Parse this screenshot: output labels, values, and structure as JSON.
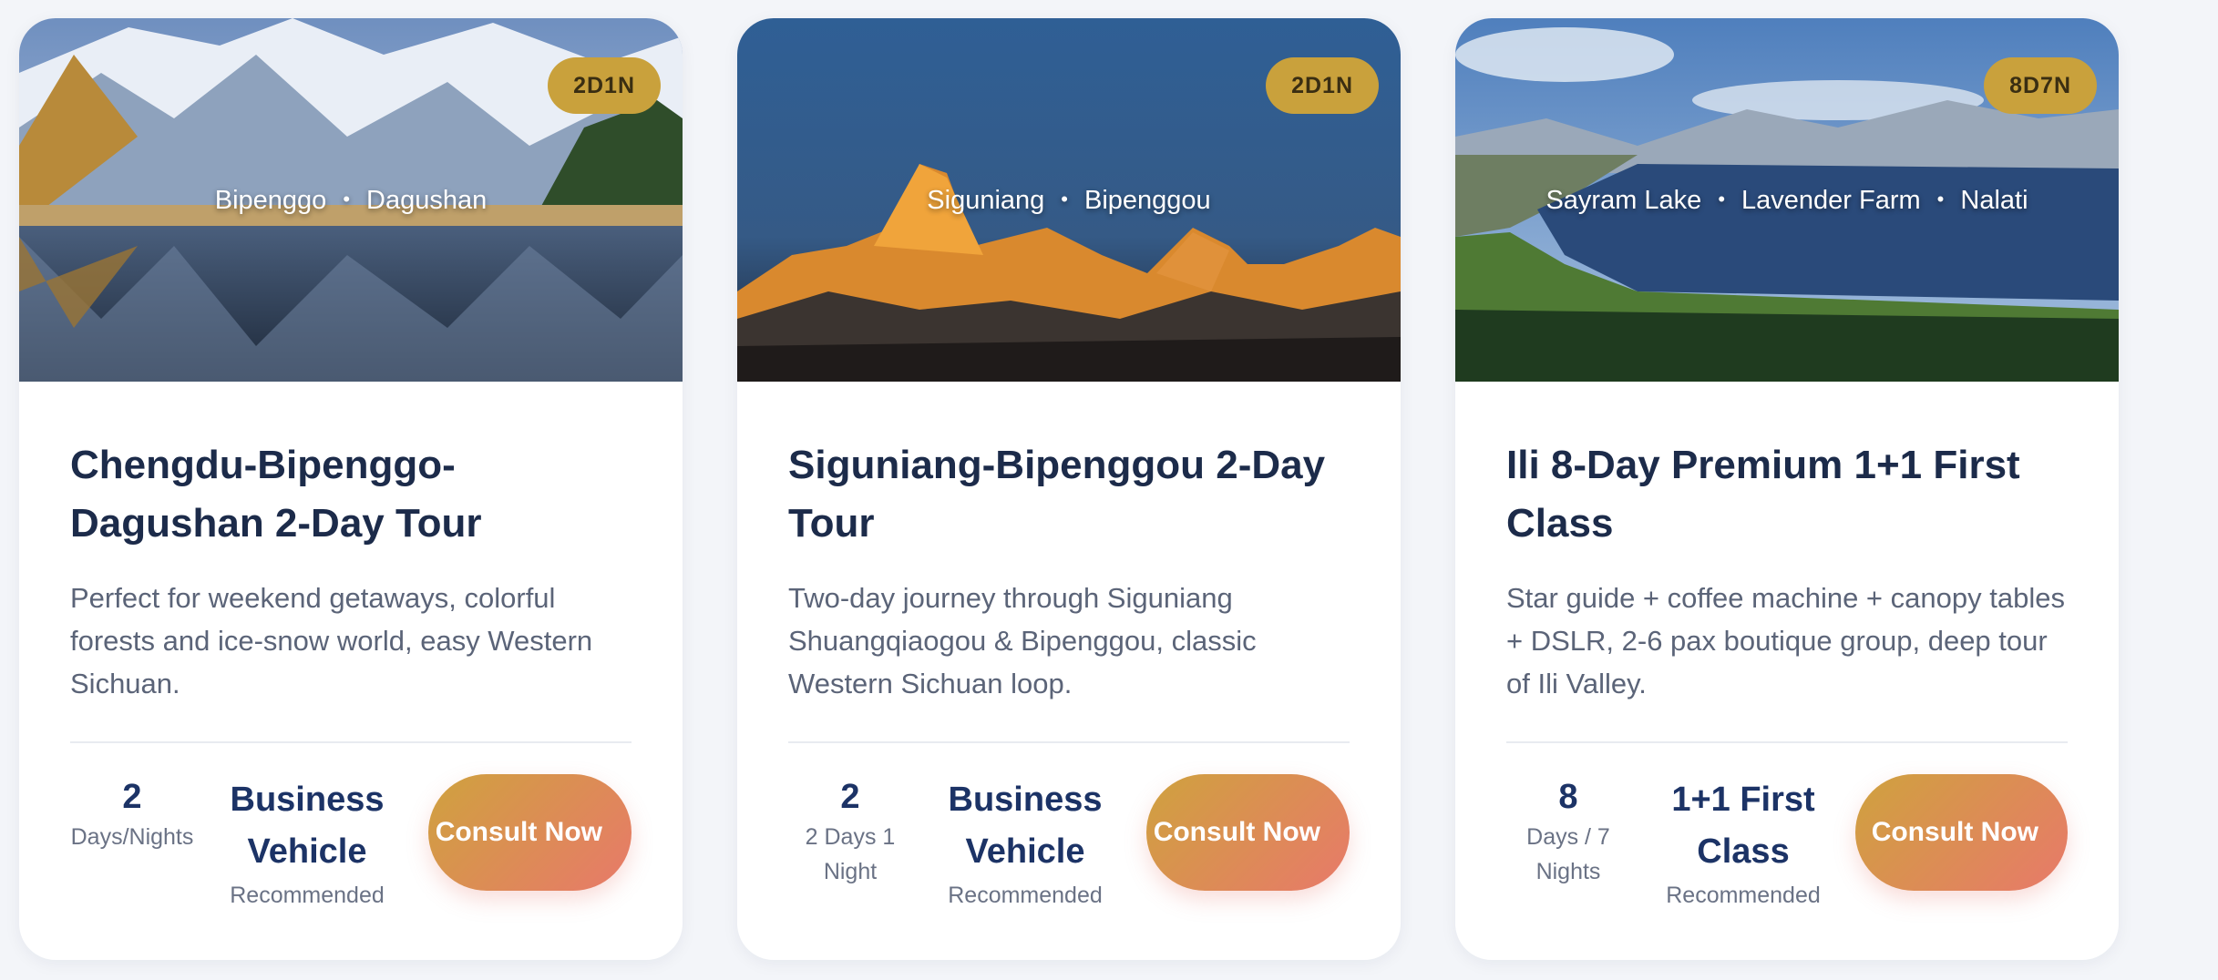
{
  "cards": [
    {
      "badge": "2D1N",
      "route": [
        "Bipenggo",
        "Dagushan"
      ],
      "title": "Chengdu-Bipenggo-Dagushan 2-Day Tour",
      "description": "Perfect for weekend getaways, colorful forests and ice-snow world, easy Western Sichuan.",
      "stat_days_value": "2",
      "stat_days_label": "Days/Nights",
      "stat_vehicle_value": "Business Vehicle",
      "stat_vehicle_label": "Recommended",
      "cta_label": "Consult Now"
    },
    {
      "badge": "2D1N",
      "route": [
        "Siguniang",
        "Bipenggou"
      ],
      "title": "Siguniang-Bipenggou 2-Day Tour",
      "description": "Two-day journey through Siguniang Shuangqiaogou & Bipenggou, classic Western Sichuan loop.",
      "stat_days_value": "2",
      "stat_days_label": "2 Days 1 Night",
      "stat_vehicle_value": "Business Vehicle",
      "stat_vehicle_label": "Recommended",
      "cta_label": "Consult Now"
    },
    {
      "badge": "8D7N",
      "route": [
        "Sayram Lake",
        "Lavender Farm",
        "Nalati"
      ],
      "title": "Ili 8-Day Premium 1+1 First Class",
      "description": "Star guide + coffee machine + canopy tables + DSLR, 2-6 pax boutique group, deep tour of Ili Valley.",
      "stat_days_value": "8",
      "stat_days_label": "Days / 7 Nights",
      "stat_vehicle_value": "1+1 First Class",
      "stat_vehicle_label": "Recommended",
      "cta_label": "Consult Now"
    }
  ],
  "colors": {
    "badge_bg": "#c9a13c",
    "title": "#1c2b4a",
    "cta_gradient_start": "#cfa23e",
    "cta_gradient_end": "#e8796a"
  }
}
